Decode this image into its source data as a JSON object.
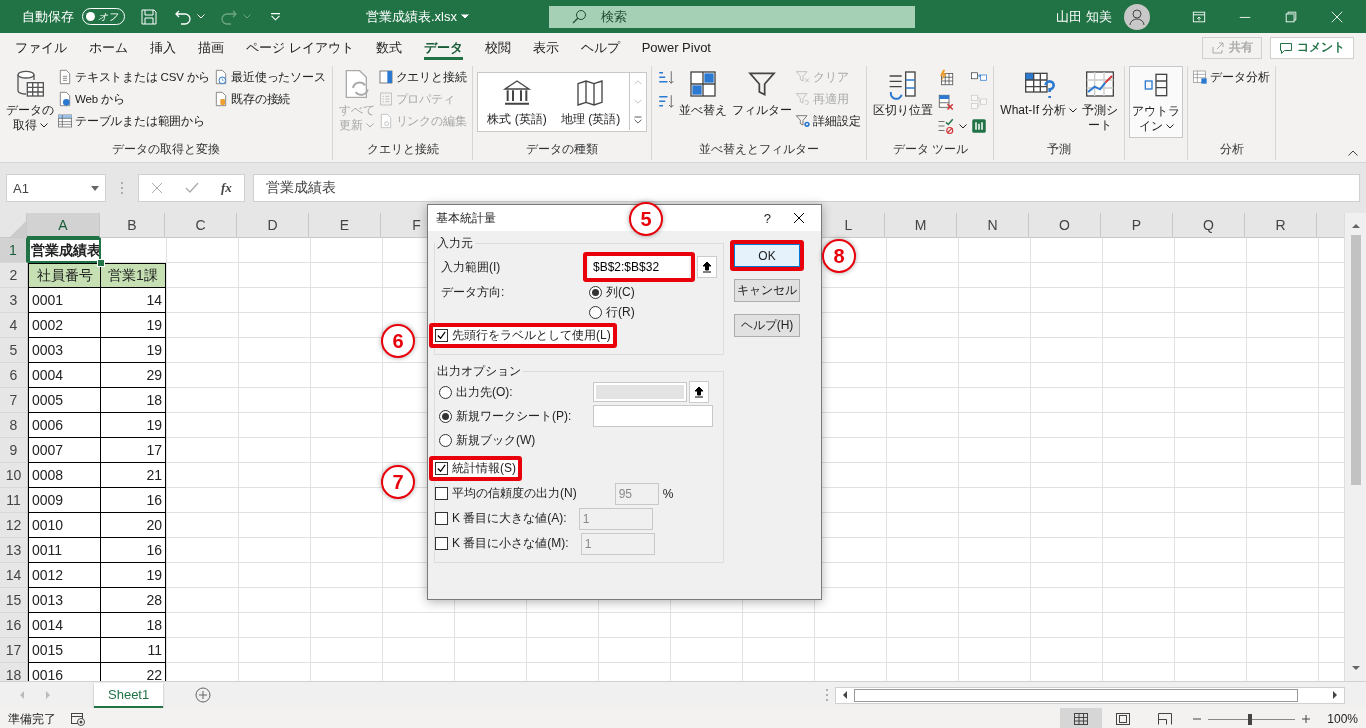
{
  "title_bar": {
    "autosave_label": "自動保存",
    "autosave_state": "オフ",
    "autosave_on": false,
    "file_name": "営業成績表.xlsx",
    "search_placeholder": "検索",
    "user_name": "山田 知美"
  },
  "ribbon_tabs": [
    {
      "label": "ファイル",
      "selected": false
    },
    {
      "label": "ホーム",
      "selected": false
    },
    {
      "label": "挿入",
      "selected": false
    },
    {
      "label": "描画",
      "selected": false
    },
    {
      "label": "ページ レイアウト",
      "selected": false
    },
    {
      "label": "数式",
      "selected": false
    },
    {
      "label": "データ",
      "selected": true
    },
    {
      "label": "校閲",
      "selected": false
    },
    {
      "label": "表示",
      "selected": false
    },
    {
      "label": "ヘルプ",
      "selected": false
    },
    {
      "label": "Power Pivot",
      "selected": false
    }
  ],
  "share_button": {
    "label": "共有",
    "disabled": true
  },
  "comment_button": {
    "label": "コメント"
  },
  "ribbon_groups": [
    {
      "label": "データの取得と変換",
      "kind": "buttons",
      "columns": [
        [
          {
            "kind": "large",
            "label": "データの取得",
            "menu": true,
            "disabled": false
          }
        ],
        [
          {
            "kind": "small",
            "label": "テキストまたは CSV から",
            "menu": false,
            "disabled": false
          },
          {
            "kind": "small",
            "label": "Web から",
            "menu": false,
            "disabled": false
          },
          {
            "kind": "small",
            "label": "テーブルまたは範囲から",
            "menu": false,
            "disabled": false
          }
        ],
        [
          {
            "kind": "small",
            "label": "最近使ったソース",
            "menu": false,
            "disabled": false
          },
          {
            "kind": "small",
            "label": "既存の接続",
            "menu": false,
            "disabled": false
          }
        ]
      ]
    },
    {
      "label": "クエリと接続",
      "kind": "buttons",
      "columns": [
        [
          {
            "kind": "large",
            "label": "すべて更新",
            "menu": true,
            "disabled": true
          }
        ],
        [
          {
            "kind": "small",
            "label": "クエリと接続",
            "menu": false,
            "disabled": false
          },
          {
            "kind": "small",
            "label": "プロパティ",
            "menu": false,
            "disabled": true
          },
          {
            "kind": "small",
            "label": "リンクの編集",
            "menu": false,
            "disabled": true
          }
        ]
      ]
    },
    {
      "label": "データの種類",
      "kind": "gallery",
      "columns": [
        [
          {
            "kind": "large",
            "label": "株式 (英語)",
            "menu": false,
            "disabled": false
          }
        ],
        [
          {
            "kind": "large",
            "label": "地理 (英語)",
            "menu": false,
            "disabled": false
          }
        ]
      ]
    },
    {
      "label": "並べ替えとフィルター",
      "kind": "buttons",
      "columns": [
        [
          {
            "kind": "icon",
            "menu": false,
            "disabled": false
          },
          {
            "kind": "icon",
            "menu": false,
            "disabled": false
          }
        ],
        [
          {
            "kind": "large",
            "label": "並べ替え",
            "menu": false,
            "disabled": false
          }
        ],
        [
          {
            "kind": "large",
            "label": "フィルター",
            "menu": false,
            "disabled": false
          }
        ],
        [
          {
            "kind": "small",
            "label": "クリア",
            "menu": false,
            "disabled": true
          },
          {
            "kind": "small",
            "label": "再適用",
            "menu": false,
            "disabled": true
          },
          {
            "kind": "small",
            "label": "詳細設定",
            "menu": false,
            "disabled": false
          }
        ]
      ]
    },
    {
      "label": "データ ツール",
      "kind": "buttons",
      "columns": [
        [
          {
            "kind": "large",
            "label": "区切り位置",
            "menu": false,
            "disabled": false
          }
        ],
        [
          {
            "kind": "icon",
            "menu": false,
            "disabled": false
          },
          {
            "kind": "icon",
            "menu": false,
            "disabled": false
          },
          {
            "kind": "icon",
            "menu": true,
            "disabled": false
          }
        ],
        [
          {
            "kind": "icon",
            "menu": false,
            "disabled": false
          },
          {
            "kind": "icon",
            "menu": false,
            "disabled": true
          },
          {
            "kind": "icon",
            "menu": false,
            "disabled": false
          }
        ]
      ]
    },
    {
      "label": "予測",
      "kind": "buttons",
      "columns": [
        [
          {
            "kind": "large",
            "label": "What-If 分析",
            "menu": true,
            "disabled": false
          }
        ],
        [
          {
            "kind": "large",
            "label": "予測シート",
            "menu": false,
            "disabled": false
          }
        ]
      ]
    },
    {
      "kind": "buttons",
      "columns": [
        [
          {
            "kind": "large",
            "label": "アウトライン",
            "menu": true,
            "disabled": false
          }
        ]
      ]
    },
    {
      "label": "分析",
      "kind": "buttons",
      "columns": [
        [
          {
            "kind": "small",
            "label": "データ分析",
            "menu": false,
            "disabled": false
          }
        ]
      ]
    }
  ],
  "formula_bar": {
    "name_box": "A1",
    "function_label": "fx",
    "formula": "営業成績表"
  },
  "column_headers": [
    {
      "label": "A",
      "selected": true
    },
    {
      "label": "B",
      "selected": false
    },
    {
      "label": "C",
      "selected": false
    },
    {
      "label": "D",
      "selected": false
    },
    {
      "label": "E",
      "selected": false
    },
    {
      "label": "F",
      "selected": false
    },
    {
      "label": "L",
      "selected": false
    },
    {
      "label": "M",
      "selected": false
    },
    {
      "label": "N",
      "selected": false
    },
    {
      "label": "O",
      "selected": false
    },
    {
      "label": "P",
      "selected": false
    },
    {
      "label": "Q",
      "selected": false
    },
    {
      "label": "R",
      "selected": false
    }
  ],
  "rows": [
    {
      "header": "1",
      "selected": true,
      "kind": "title",
      "values": [
        "営業成績表"
      ]
    },
    {
      "header": "2",
      "selected": false,
      "kind": "header",
      "values": [
        "社員番号",
        "営業1課"
      ]
    },
    {
      "header": "3",
      "selected": false,
      "kind": "data",
      "values": [
        "0001",
        "14"
      ]
    },
    {
      "header": "4",
      "selected": false,
      "kind": "data",
      "values": [
        "0002",
        "19"
      ]
    },
    {
      "header": "5",
      "selected": false,
      "kind": "data",
      "values": [
        "0003",
        "19"
      ]
    },
    {
      "header": "6",
      "selected": false,
      "kind": "data",
      "values": [
        "0004",
        "29"
      ]
    },
    {
      "header": "7",
      "selected": false,
      "kind": "data",
      "values": [
        "0005",
        "18"
      ]
    },
    {
      "header": "8",
      "selected": false,
      "kind": "data",
      "values": [
        "0006",
        "19"
      ]
    },
    {
      "header": "9",
      "selected": false,
      "kind": "data",
      "values": [
        "0007",
        "17"
      ]
    },
    {
      "header": "10",
      "selected": false,
      "kind": "data",
      "values": [
        "0008",
        "21"
      ]
    },
    {
      "header": "11",
      "selected": false,
      "kind": "data",
      "values": [
        "0009",
        "16"
      ]
    },
    {
      "header": "12",
      "selected": false,
      "kind": "data",
      "values": [
        "0010",
        "20"
      ]
    },
    {
      "header": "13",
      "selected": false,
      "kind": "data",
      "values": [
        "0011",
        "16"
      ]
    },
    {
      "header": "14",
      "selected": false,
      "kind": "data",
      "values": [
        "0012",
        "19"
      ]
    },
    {
      "header": "15",
      "selected": false,
      "kind": "data",
      "values": [
        "0013",
        "28"
      ]
    },
    {
      "header": "16",
      "selected": false,
      "kind": "data",
      "values": [
        "0014",
        "18"
      ]
    },
    {
      "header": "17",
      "selected": false,
      "kind": "data",
      "values": [
        "0015",
        "11"
      ]
    },
    {
      "header": "18",
      "selected": false,
      "kind": "data",
      "values": [
        "0016",
        "22"
      ]
    }
  ],
  "sheet_tabs": [
    {
      "label": "Sheet1",
      "selected": true
    }
  ],
  "dialog": {
    "title": "基本統計量",
    "help_button": "?",
    "input_group": {
      "legend": "入力元",
      "range_label": "入力範囲(I)",
      "range_value": "$B$2:$B$32",
      "range_highlighted": true,
      "direction_label": "データ方向:",
      "directions": [
        {
          "label": "列(C)",
          "selected": true
        },
        {
          "label": "行(R)",
          "selected": false
        }
      ],
      "labels_option": {
        "label": "先頭行をラベルとして使用(L)",
        "checked": true,
        "highlighted": true
      }
    },
    "output_group": {
      "legend": "出力オプション",
      "destinations": [
        {
          "label": "出力先(O):",
          "selected": false,
          "kind": "ref",
          "field_disabled": true
        },
        {
          "label": "新規ワークシート(P):",
          "selected": true,
          "kind": "plain",
          "field_disabled": false
        },
        {
          "label": "新規ブック(W)",
          "selected": false,
          "kind": "none"
        }
      ],
      "options": [
        {
          "label": "統計情報(S)",
          "checked": true,
          "highlighted": true
        },
        {
          "label": "平均の信頼度の出力(N)",
          "checked": false,
          "highlighted": false,
          "value": "95",
          "unit": "%"
        },
        {
          "label": "K 番目に大きな値(A):",
          "checked": false,
          "highlighted": false,
          "value": "1"
        },
        {
          "label": "K 番目に小さな値(M):",
          "checked": false,
          "highlighted": false,
          "value": "1"
        }
      ]
    },
    "buttons": [
      {
        "label": "OK",
        "default": true,
        "highlighted": true
      },
      {
        "label": "キャンセル",
        "default": false,
        "highlighted": false
      },
      {
        "label": "ヘルプ(H)",
        "default": false,
        "highlighted": false
      }
    ],
    "annotations": [
      {
        "number": "5"
      },
      {
        "number": "6"
      },
      {
        "number": "7"
      },
      {
        "number": "8"
      }
    ]
  },
  "status_bar": {
    "status": "準備完了",
    "views": [
      {
        "selected": true
      },
      {
        "selected": false
      },
      {
        "selected": false
      }
    ],
    "zoom": {
      "level": 0.48,
      "reading": "100%"
    }
  }
}
